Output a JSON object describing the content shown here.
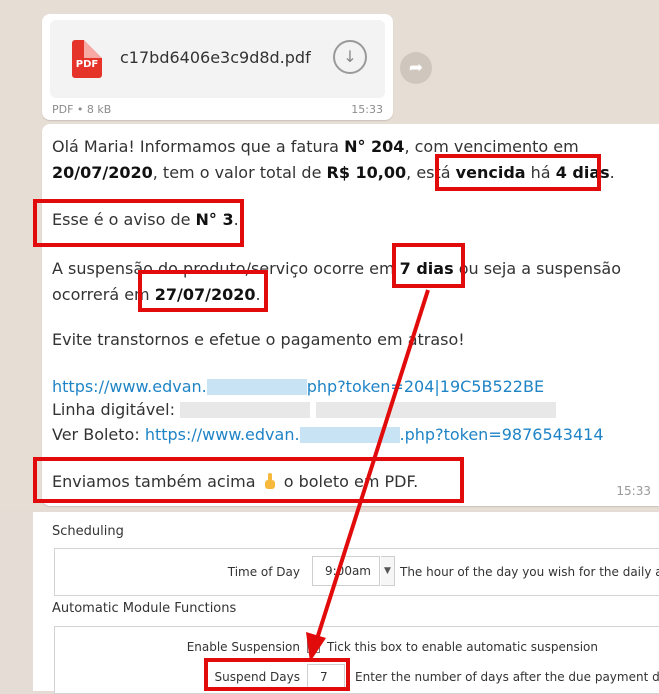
{
  "file_message": {
    "file_icon_label": "PDF",
    "file_name": "c17bd6406e3c9d8d.pdf",
    "meta": "PDF • 8 kB",
    "time": "15:33"
  },
  "message": {
    "line1_a": "Olá Maria! Informamos que a fatura ",
    "line1_b": "N° 204",
    "line1_c": ", com vencimento em",
    "line2_a": "20/07/2020",
    "line2_b": ", tem o valor total de ",
    "line2_c": "R$ 10,00",
    "line2_d": ", está ",
    "line2_e": "vencida",
    "line2_f": " há ",
    "line2_g": "4 dias",
    "line2_h": ".",
    "line3_a": "Esse é o aviso de ",
    "line3_b": "N° 3",
    "line3_c": ".",
    "line4_a": "A suspensão do produto/serviço ocorre em ",
    "line4_b": "7 dias",
    "line4_c": " ou seja a suspensão",
    "line5_a": "ocorrerá em ",
    "line5_b": "27/07/2020",
    "line5_c": ".",
    "line6": "Evite transtornos e efetue o pagamento em atraso!",
    "link1_a": "https://www.edvan.",
    "link1_b": "php?token=204|19C5B522BE",
    "line8": "Linha digitável:",
    "line9_label": "Ver Boleto: ",
    "link2_a": "https://www.edvan.",
    "link2_b": ".php?token=9876543414",
    "line10_a": "Enviamos também acima ",
    "line10_b": " o boleto em PDF.",
    "time": "15:33"
  },
  "settings": {
    "scheduling_title": "Scheduling",
    "time_of_day_label": "Time of Day",
    "time_of_day_value": "9:00am",
    "time_of_day_help": "The hour of the day you wish for the daily auto",
    "automatic_title": "Automatic Module Functions",
    "enable_suspension_label": "Enable Suspension",
    "enable_suspension_help": "Tick this box to enable automatic suspension",
    "suspend_days_label": "Suspend Days",
    "suspend_days_value": "7",
    "suspend_days_help": "Enter the number of days after the due payment date y"
  },
  "colors": {
    "annotation_red": "#e20b0b",
    "link_blue": "#1f84c6",
    "chat_background": "#e6ddd4"
  }
}
